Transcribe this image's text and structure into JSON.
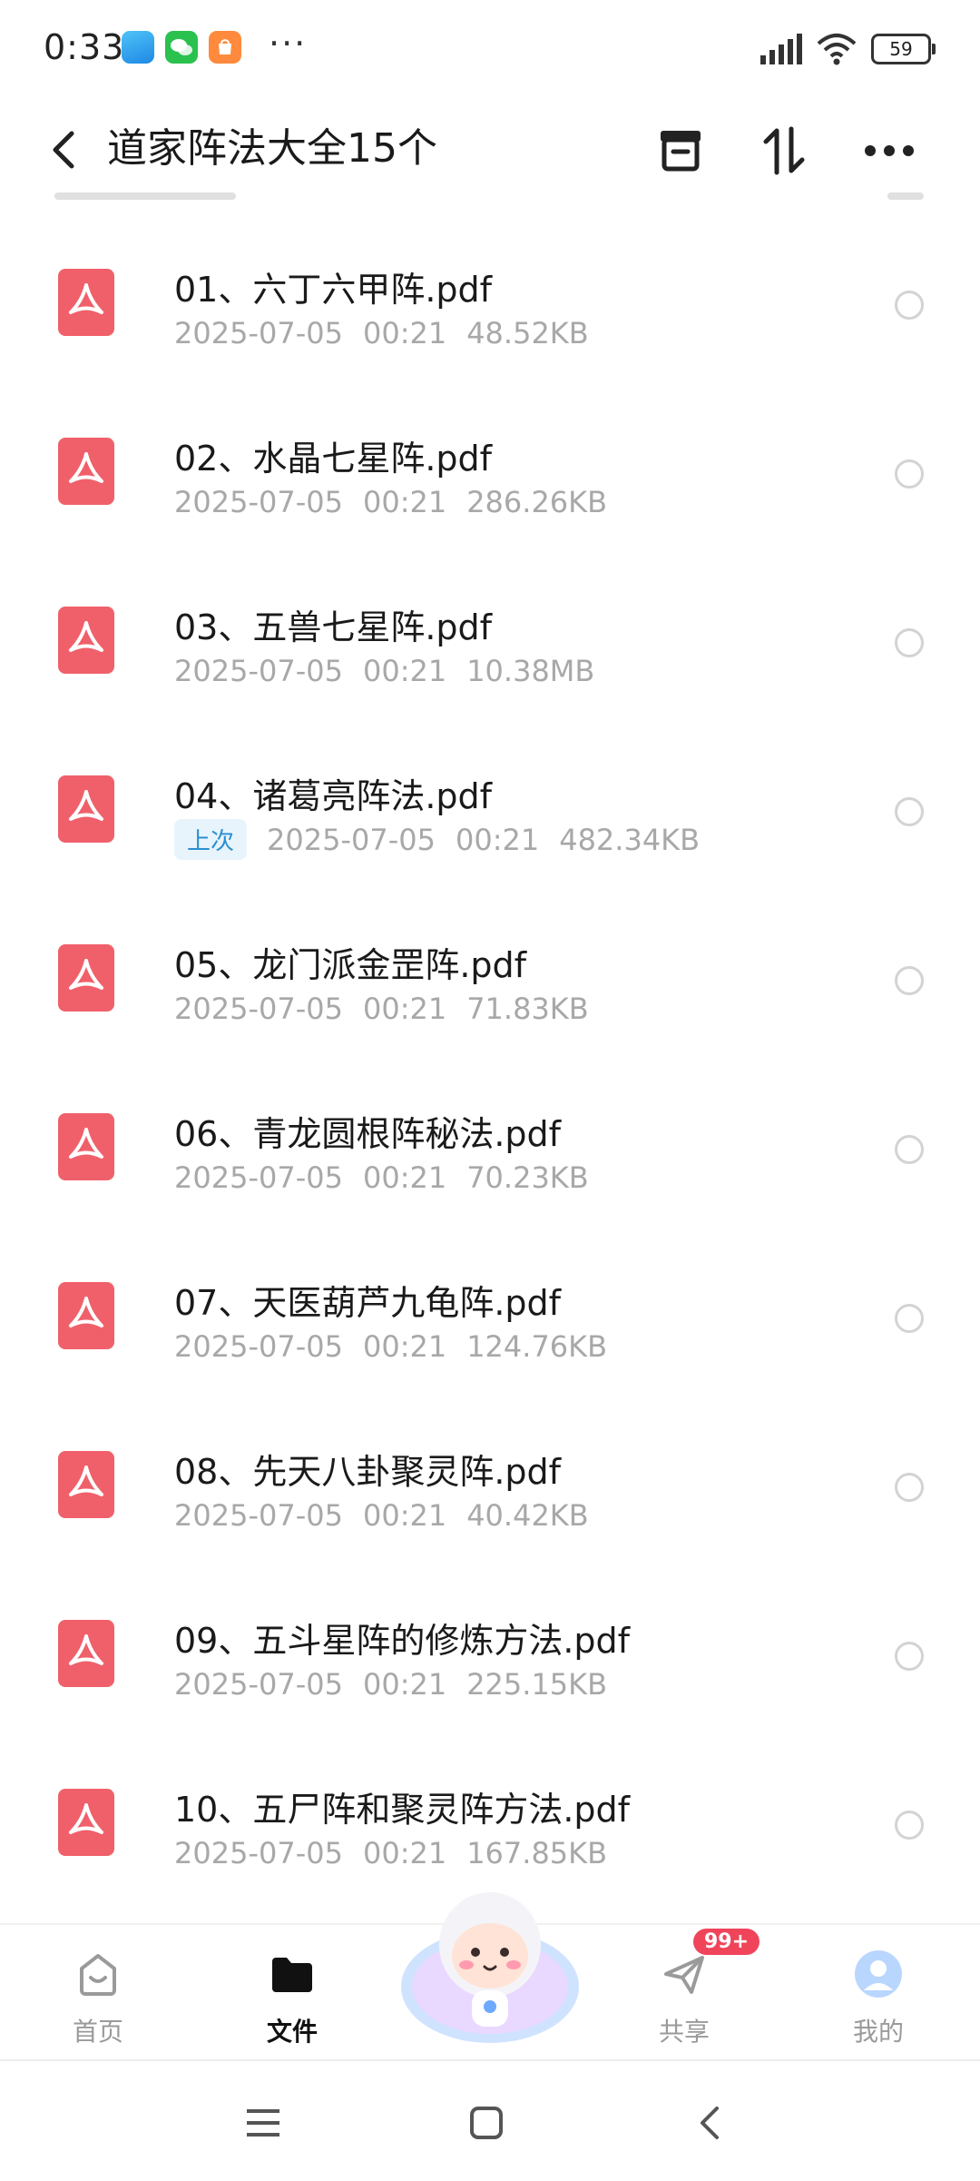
{
  "status_bar": {
    "time": "0:33",
    "battery": "59",
    "more": "···"
  },
  "header": {
    "title": "道家阵法大全15个"
  },
  "files": [
    {
      "name": "01、六丁六甲阵.pdf",
      "date": "2025-07-05",
      "time": "00:21",
      "size": "48.52KB",
      "tag": ""
    },
    {
      "name": "02、水晶七星阵.pdf",
      "date": "2025-07-05",
      "time": "00:21",
      "size": "286.26KB",
      "tag": ""
    },
    {
      "name": "03、五兽七星阵.pdf",
      "date": "2025-07-05",
      "time": "00:21",
      "size": "10.38MB",
      "tag": ""
    },
    {
      "name": "04、诸葛亮阵法.pdf",
      "date": "2025-07-05",
      "time": "00:21",
      "size": "482.34KB",
      "tag": "上次"
    },
    {
      "name": "05、龙门派金罡阵.pdf",
      "date": "2025-07-05",
      "time": "00:21",
      "size": "71.83KB",
      "tag": ""
    },
    {
      "name": "06、青龙圆根阵秘法.pdf",
      "date": "2025-07-05",
      "time": "00:21",
      "size": "70.23KB",
      "tag": ""
    },
    {
      "name": "07、天医葫芦九龟阵.pdf",
      "date": "2025-07-05",
      "time": "00:21",
      "size": "124.76KB",
      "tag": ""
    },
    {
      "name": "08、先天八卦聚灵阵.pdf",
      "date": "2025-07-05",
      "time": "00:21",
      "size": "40.42KB",
      "tag": ""
    },
    {
      "name": "09、五斗星阵的修炼方法.pdf",
      "date": "2025-07-05",
      "time": "00:21",
      "size": "225.15KB",
      "tag": ""
    },
    {
      "name": "10、五尸阵和聚灵阵方法.pdf",
      "date": "2025-07-05",
      "time": "00:21",
      "size": "167.85KB",
      "tag": ""
    }
  ],
  "bottom_nav": {
    "home": "首页",
    "files": "文件",
    "share": "共享",
    "share_badge": "99+",
    "mine": "我的"
  },
  "colors": {
    "pdf_icon": "#f0606a",
    "tag_text": "#2a8fd0",
    "badge": "#f0445a"
  }
}
